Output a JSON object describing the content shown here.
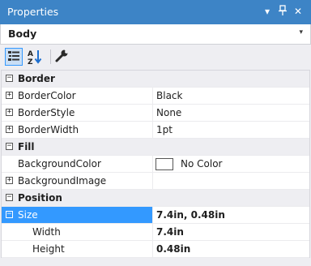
{
  "window": {
    "title": "Properties",
    "dropdown_glyph": "▾",
    "pin_glyph": "📌",
    "close_glyph": "✕"
  },
  "selector": {
    "value": "Body",
    "arrow_glyph": "▾"
  },
  "toolbar": {
    "buttons": [
      {
        "name": "categorized-icon",
        "active": true
      },
      {
        "name": "alphabetical-icon",
        "active": false
      },
      {
        "name": "property-pages-icon",
        "active": false
      }
    ]
  },
  "grid": {
    "colors": {
      "selection": "#3399ff",
      "category_bg": "#eeeef2"
    },
    "rows": [
      {
        "type": "category",
        "label": "Border",
        "expander": "−"
      },
      {
        "type": "property",
        "label": "BorderColor",
        "value": "Black",
        "expander": "+"
      },
      {
        "type": "property",
        "label": "BorderStyle",
        "value": "None",
        "expander": "+"
      },
      {
        "type": "property",
        "label": "BorderWidth",
        "value": "1pt",
        "expander": "+"
      },
      {
        "type": "category",
        "label": "Fill",
        "expander": "−"
      },
      {
        "type": "property",
        "label": "BackgroundColor",
        "value": "No Color"
      },
      {
        "type": "property",
        "label": "BackgroundImage",
        "value": "",
        "expander": "+"
      },
      {
        "type": "category",
        "label": "Position",
        "expander": "−"
      },
      {
        "type": "property",
        "label": "Size",
        "value": "7.4in, 0.48in",
        "expander": "−",
        "selected": true
      },
      {
        "type": "sub",
        "label": "Width",
        "value": "7.4in"
      },
      {
        "type": "sub",
        "label": "Height",
        "value": "0.48in"
      }
    ]
  }
}
